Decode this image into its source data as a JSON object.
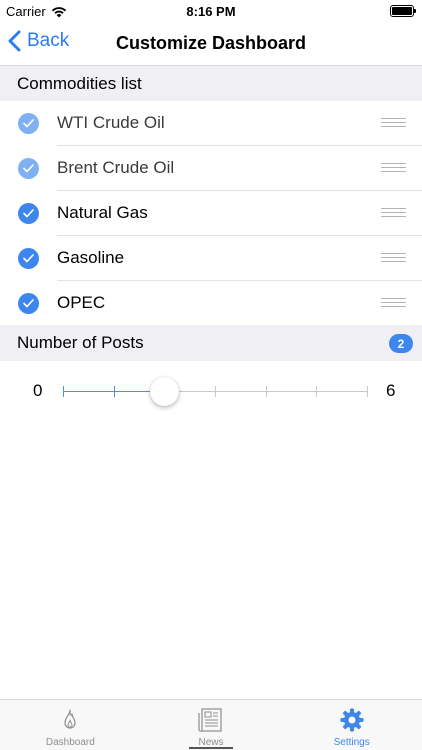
{
  "status_bar": {
    "carrier": "Carrier",
    "time": "8:16 PM"
  },
  "nav": {
    "back_label": "Back",
    "title": "Customize Dashboard"
  },
  "commodities": {
    "header": "Commodities list",
    "items": [
      {
        "label": "WTI Crude Oil",
        "checked": true,
        "dimmed": true
      },
      {
        "label": "Brent Crude Oil",
        "checked": true,
        "dimmed": true
      },
      {
        "label": "Natural Gas",
        "checked": true,
        "dimmed": false
      },
      {
        "label": "Gasoline",
        "checked": true,
        "dimmed": false
      },
      {
        "label": "OPEC",
        "checked": true,
        "dimmed": false
      }
    ]
  },
  "posts": {
    "header": "Number of Posts",
    "badge": "2",
    "slider": {
      "min_label": "0",
      "max_label": "6",
      "min": 0,
      "max": 6,
      "value": 2
    }
  },
  "tabs": [
    {
      "label": "Dashboard",
      "icon": "flame-icon",
      "active": false
    },
    {
      "label": "News",
      "icon": "newspaper-icon",
      "active": false
    },
    {
      "label": "Settings",
      "icon": "gear-icon",
      "active": true
    }
  ],
  "colors": {
    "accent": "#3c86ee",
    "section_bg": "#efeff4"
  }
}
